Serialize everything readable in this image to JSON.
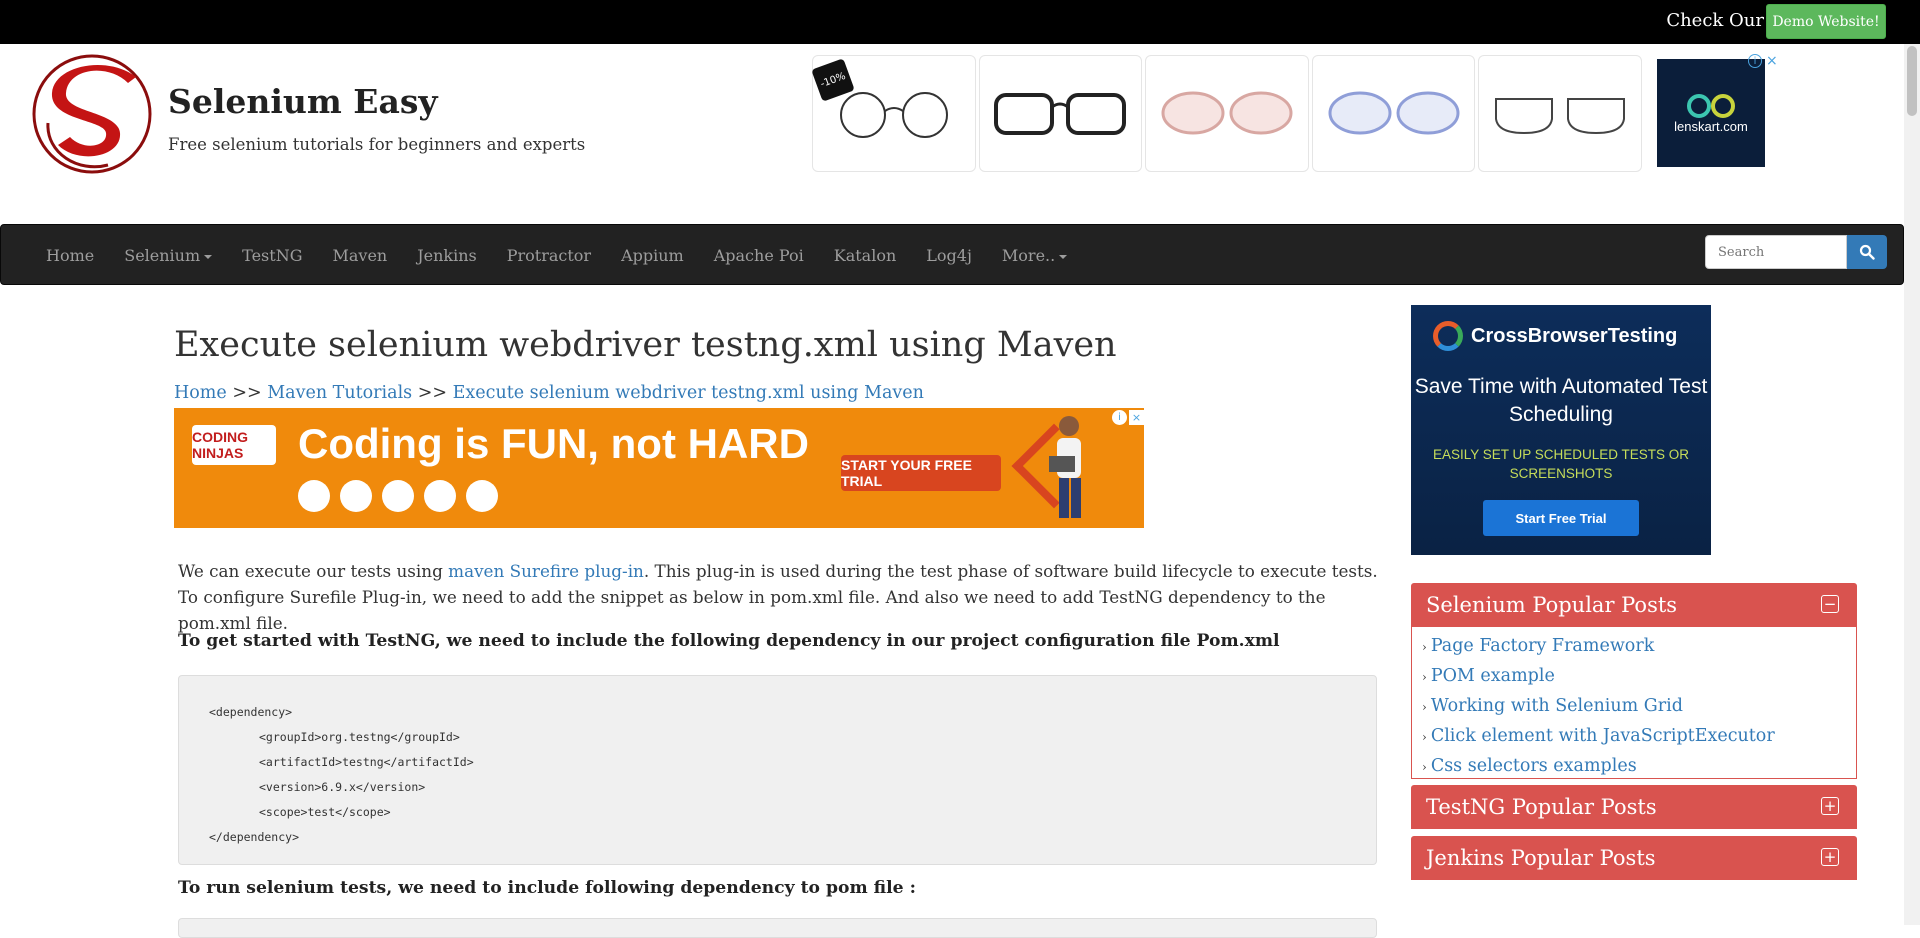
{
  "topbar": {
    "check_text": "Check Our",
    "demo_button": "Demo Website!"
  },
  "header": {
    "title": "Selenium Easy",
    "tagline": "Free selenium tutorials for beginners and experts"
  },
  "header_ad": {
    "discount_tag": "-10%",
    "brand": "lenskart.com",
    "info": "i",
    "close": "×"
  },
  "nav": {
    "items": [
      "Home",
      "Selenium",
      "TestNG",
      "Maven",
      "Jenkins",
      "Protractor",
      "Appium",
      "Apache Poi",
      "Katalon",
      "Log4j",
      "More.."
    ],
    "search_placeholder": "Search"
  },
  "article": {
    "title": "Execute selenium webdriver testng.xml using Maven",
    "breadcrumb": {
      "home": "Home",
      "sep": ">>",
      "section": "Maven Tutorials",
      "current": "Execute selenium webdriver testng.xml using Maven"
    },
    "intro_before_link": "We can execute our tests using ",
    "intro_link": "maven Surefire plug-in",
    "intro_after_link": ". This plug-in is used during the test phase of software build lifecycle to execute tests. To configure Surefile Plug-in, we need to add the snippet as below in pom.xml file. And also we need to add TestNG dependency to the pom.xml file.",
    "heading_get_started": "To get started with TestNG, we need to include the following dependency in our project configuration file Pom.xml",
    "code_lines": [
      "<dependency>",
      "<groupId>org.testng</groupId>",
      "<artifactId>testng</artifactId>",
      "<version>6.9.x</version>",
      "<scope>test</scope>",
      "</dependency>"
    ],
    "heading_run": "To run selenium tests, we need to include following dependency to pom file :"
  },
  "banner_ad": {
    "logo_text": "CODING NINJAS",
    "headline": "Coding is FUN, not HARD",
    "cta": "START YOUR FREE TRIAL",
    "info": "i",
    "close": "×"
  },
  "sidebar_ad": {
    "brand": "CrossBrowserTesting",
    "line1": "Save Time with Automated Test Scheduling",
    "line2": "EASILY SET UP SCHEDULED TESTS OR SCREENSHOTS",
    "button": "Start Free Trial"
  },
  "sidebar": {
    "selenium_title": "Selenium Popular Posts",
    "selenium_posts": [
      "Page Factory Framework",
      "POM example",
      "Working with Selenium Grid",
      "Click element with JavaScriptExecutor",
      "Css selectors examples"
    ],
    "testng_title": "TestNG Popular Posts",
    "jenkins_title": "Jenkins Popular Posts",
    "bullet": "›",
    "minus": "−",
    "plus": "+"
  },
  "colors": {
    "nav_bg": "#222222",
    "panel_red": "#d9534f",
    "link_blue": "#337ab7",
    "demo_green": "#5cb85c"
  }
}
